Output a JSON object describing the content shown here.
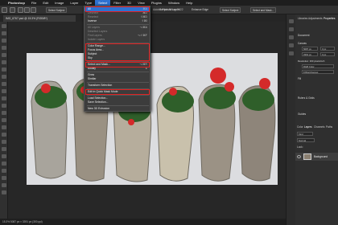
{
  "menubar": {
    "apple": "",
    "app": "Photoshop",
    "items": [
      "File",
      "Edit",
      "Image",
      "Layer",
      "Type",
      "Select",
      "Filter",
      "3D",
      "View",
      "Plugins",
      "Window",
      "Help"
    ],
    "active_index": 5
  },
  "options_bar": {
    "select_subject": "Select Subject",
    "sample_all_layers": "Sample All Layers",
    "enhance_edge": "Enhance Edge",
    "select_subject_right": "Select Subject",
    "select_and_mask": "Select and Mask..."
  },
  "app_title": "Adobe Photoshop 2022",
  "document_tab": "IMG_6767.psd @ 15.3% (RGB/8*)",
  "select_menu": {
    "groups": [
      [
        {
          "label": "All",
          "shortcut": "⌘A",
          "enabled": true,
          "highlighted": true
        },
        {
          "label": "Deselect",
          "shortcut": "⌘D",
          "enabled": false
        },
        {
          "label": "Reselect",
          "shortcut": "⇧⌘D",
          "enabled": false
        },
        {
          "label": "Inverse",
          "shortcut": "⇧⌘I",
          "enabled": true
        }
      ],
      [
        {
          "label": "All Layers",
          "shortcut": "⌥⌘A",
          "enabled": false
        },
        {
          "label": "Deselect Layers",
          "shortcut": "",
          "enabled": false
        },
        {
          "label": "Find Layers",
          "shortcut": "⌥⇧⌘F",
          "enabled": false
        },
        {
          "label": "Isolate Layers",
          "shortcut": "",
          "enabled": false
        }
      ],
      [
        {
          "label": "Color Range...",
          "shortcut": "",
          "enabled": true
        },
        {
          "label": "Focus Area...",
          "shortcut": "",
          "enabled": true
        },
        {
          "label": "Subject",
          "shortcut": "",
          "enabled": true
        },
        {
          "label": "Sky",
          "shortcut": "",
          "enabled": true
        }
      ],
      [
        {
          "label": "Select and Mask...",
          "shortcut": "⌥⌘R",
          "enabled": true
        },
        {
          "label": "Modify",
          "shortcut": "▸",
          "enabled": true
        }
      ],
      [
        {
          "label": "Grow",
          "shortcut": "",
          "enabled": true
        },
        {
          "label": "Similar",
          "shortcut": "",
          "enabled": true
        }
      ],
      [
        {
          "label": "Transform Selection",
          "shortcut": "",
          "enabled": true
        }
      ],
      [
        {
          "label": "Edit in Quick Mask Mode",
          "shortcut": "",
          "enabled": true
        }
      ],
      [
        {
          "label": "Load Selection...",
          "shortcut": "",
          "enabled": true
        },
        {
          "label": "Save Selection...",
          "shortcut": "",
          "enabled": true
        }
      ],
      [
        {
          "label": "New 3D Extrusion",
          "shortcut": "",
          "enabled": true
        }
      ]
    ]
  },
  "right_panel": {
    "tabs": [
      "Libraries",
      "Adjustments",
      "Properties"
    ],
    "section_document": "Document",
    "canvas_label": "Canvas",
    "width": "5087 px",
    "height": "3391 px",
    "x": "0 px",
    "y": "0 px",
    "resolution": "Resolution: 300 pixels/inch",
    "mode": "RGB Color",
    "bit_depth": "8 Bits/Channel",
    "fill": "Fill",
    "rulers_grids": "Rulers & Grids",
    "guides": "Guides",
    "layers_tabs": [
      "Color",
      "Layers",
      "Channels",
      "Paths"
    ],
    "kind": "Kind",
    "normal": "Normal",
    "lock": "Lock:",
    "layer_name": "Background"
  },
  "status": "15.3%     5087 px × 3391 px (300 ppi)",
  "colors": {
    "accent": "#2e72d2",
    "highlight_box": "#e02020"
  }
}
